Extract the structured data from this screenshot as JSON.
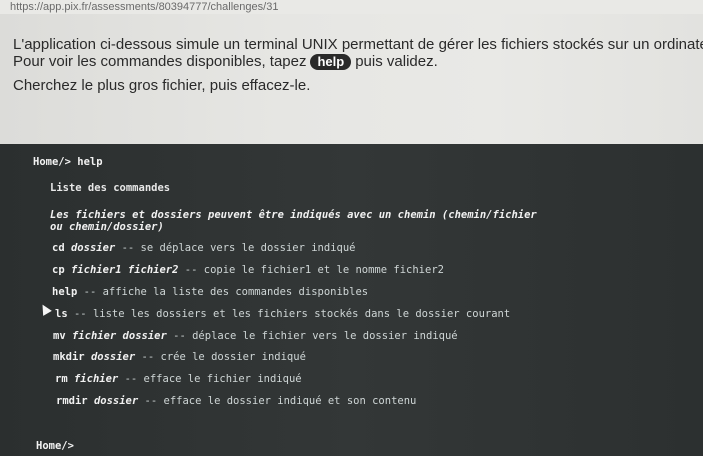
{
  "browser": {
    "url": "https://app.pix.fr/assessments/80394777/challenges/31"
  },
  "instructions": {
    "line1": "L'application ci-dessous simule un terminal UNIX permettant de gérer les fichiers stockés sur un ordinateur.",
    "line2_before": "Pour voir les commandes disponibles, tapez",
    "help_badge": "help",
    "line2_after": "puis validez.",
    "line3": "Cherchez le plus gros fichier, puis effacez-le."
  },
  "terminal": {
    "prompt_help": "Home/> help",
    "header": "Liste des commandes",
    "paths_note_1": "Les fichiers et dossiers peuvent être indiqués avec un chemin (chemin/fichier",
    "paths_note_2": "ou chemin/dossier)",
    "commands": [
      {
        "cmd": "cd",
        "args": "dossier",
        "desc": "-- se déplace vers le dossier indiqué"
      },
      {
        "cmd": "cp",
        "args": "fichier1 fichier2",
        "desc": "-- copie le fichier1 et le nomme fichier2"
      },
      {
        "cmd": "help",
        "args": "",
        "desc": "-- affiche la liste des commandes disponibles"
      },
      {
        "cmd": "ls",
        "args": "",
        "desc": "-- liste les dossiers et les fichiers stockés dans le dossier courant"
      },
      {
        "cmd": "mv",
        "args": "fichier dossier",
        "desc": "-- déplace le fichier vers le dossier indiqué"
      },
      {
        "cmd": "mkdir",
        "args": "dossier",
        "desc": "-- crée le dossier indiqué"
      },
      {
        "cmd": "rm",
        "args": "fichier",
        "desc": "-- efface le fichier indiqué"
      },
      {
        "cmd": "rmdir",
        "args": "dossier",
        "desc": "-- efface le dossier indiqué et son contenu"
      }
    ],
    "prompt_current": "Home/>"
  }
}
